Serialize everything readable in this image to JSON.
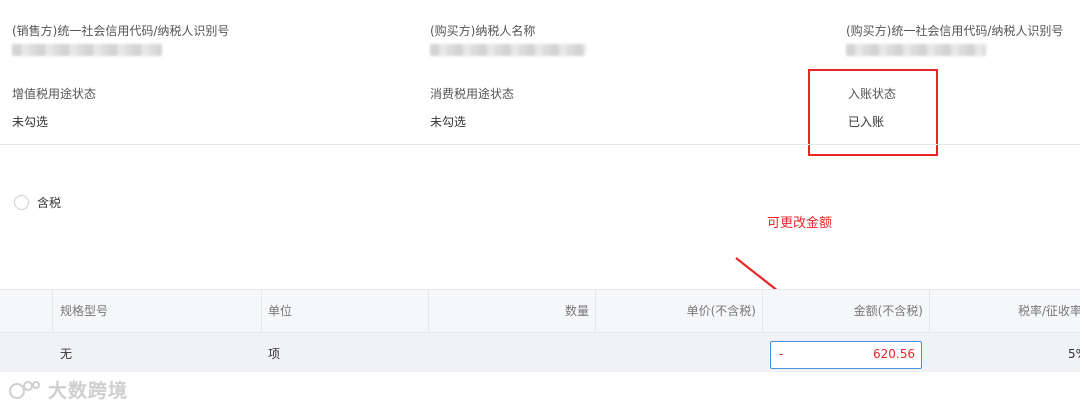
{
  "info": {
    "seller_tax_id": {
      "label": "(销售方)统一社会信用代码/纳税人识别号"
    },
    "buyer_name": {
      "label": "(购买方)纳税人名称"
    },
    "buyer_tax_id": {
      "label": "(购买方)统一社会信用代码/纳税人识别号"
    },
    "vat_usage": {
      "label": "增值税用途状态",
      "value": "未勾选"
    },
    "consumption_tax_usage": {
      "label": "消费税用途状态",
      "value": "未勾选"
    },
    "accounting_status": {
      "label": "入账状态",
      "value": "已入账"
    }
  },
  "tax_option": {
    "label": "含税"
  },
  "annotation": {
    "text": "可更改金额",
    "color": "#e8262a"
  },
  "table": {
    "columns": [
      "规格型号",
      "单位",
      "数量",
      "单价(不含税)",
      "金额(不含税)",
      "税率/征收率"
    ],
    "row": {
      "spec": "无",
      "unit": "项",
      "quantity": "",
      "unit_price": "",
      "amount_prefix": "-",
      "amount": "620.56",
      "tax_rate": "5%"
    }
  },
  "watermark": {
    "text": "大数跨境"
  },
  "colors": {
    "accent_red": "#e8262a",
    "input_border": "#4a90e2"
  }
}
